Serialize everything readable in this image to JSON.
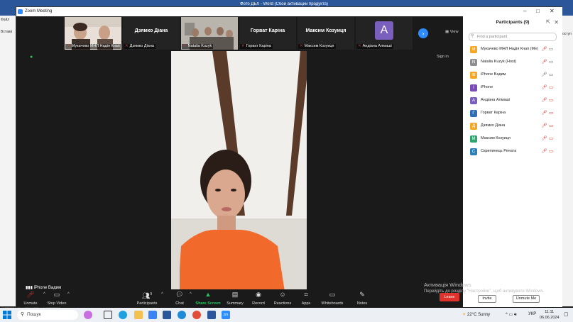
{
  "word": {
    "title": "Фото ДБХ - Word (Сбой активации продукта)",
    "left_labels": [
      "Файл",
      "Встави"
    ],
    "right_label": "оступ",
    "status_left": "Страница 1 из 1   Число слов: 0   Ф  украинский"
  },
  "zoom": {
    "title": "Zoom Meeting",
    "view_label": "View",
    "sign_in": "Sign in",
    "active_speaker": "iPhone Вадим",
    "strip": [
      {
        "name": "Мукачево МНЛ Надія Кнап",
        "muted": true,
        "kind": "video"
      },
      {
        "name": "Дзямко Діана",
        "big": "Дзямко Діана",
        "muted": true,
        "kind": "name"
      },
      {
        "name": "Natalia Kuzyk",
        "muted": true,
        "kind": "video"
      },
      {
        "name": "Горват Каріна",
        "big": "Горват Каріна",
        "muted": true,
        "kind": "name"
      },
      {
        "name": "Максим Козуиця",
        "big": "Максим  Козуиця",
        "muted": true,
        "kind": "name"
      },
      {
        "name": "Андіана Алмаші",
        "letter": "A",
        "muted": true,
        "kind": "avatar"
      }
    ],
    "toolbar": {
      "unmute": "Unmute",
      "stop_video": "Stop Video",
      "participants": "Participants",
      "participants_count": "9",
      "chat": "Chat",
      "share_screen": "Share Screen",
      "summary": "Summary",
      "record": "Record",
      "reactions": "Reactions",
      "apps": "Apps",
      "whiteboards": "Whiteboards",
      "notes": "Notes",
      "leave": "Leave"
    }
  },
  "participants": {
    "title": "Participants (9)",
    "search_placeholder": "Find a participant",
    "invite": "Invite",
    "unmute_me": "Unmute Me",
    "list": [
      {
        "letter": "M",
        "name": "Мукачево МНЛ Надія Кнап (Me)",
        "color": "#f5a623",
        "mic_on": false,
        "cam_on": true
      },
      {
        "letter": "N",
        "name": "Natalia Kuzyk (Host)",
        "color": "#8e8e93",
        "mic_on": false,
        "cam_on": true
      },
      {
        "letter": "IB",
        "name": "iPhone Вадим",
        "color": "#f5a623",
        "mic_on": true,
        "cam_on": true
      },
      {
        "letter": "I",
        "name": "iPhone",
        "color": "#7b4bb8",
        "mic_on": false,
        "cam_on": false
      },
      {
        "letter": "A",
        "name": "Андіана Алмаші",
        "color": "#7b5fbf",
        "mic_on": false,
        "cam_on": false
      },
      {
        "letter": "Г",
        "name": "Горват Каріна",
        "color": "#2d6fb8",
        "mic_on": false,
        "cam_on": false
      },
      {
        "letter": "Д",
        "name": "Дзямко Діана",
        "color": "#f5a623",
        "mic_on": false,
        "cam_on": false
      },
      {
        "letter": "M",
        "name": "Максим Козуиця",
        "color": "#2ea46f",
        "mic_on": false,
        "cam_on": false
      },
      {
        "letter": "C",
        "name": "Скрипинець Рената",
        "color": "#2d7fb8",
        "mic_on": false,
        "cam_on": false
      }
    ]
  },
  "activation": {
    "line1": "Активація Windows",
    "line2": "Перейдіть до розділу \"Настройки\", щоб активувати Windows."
  },
  "taskbar": {
    "search": "Пошук",
    "weather": "22°C  Sunny",
    "lang": "УКР",
    "time": "11:11",
    "date": "06.06.2024",
    "zoom_app": "zm"
  }
}
